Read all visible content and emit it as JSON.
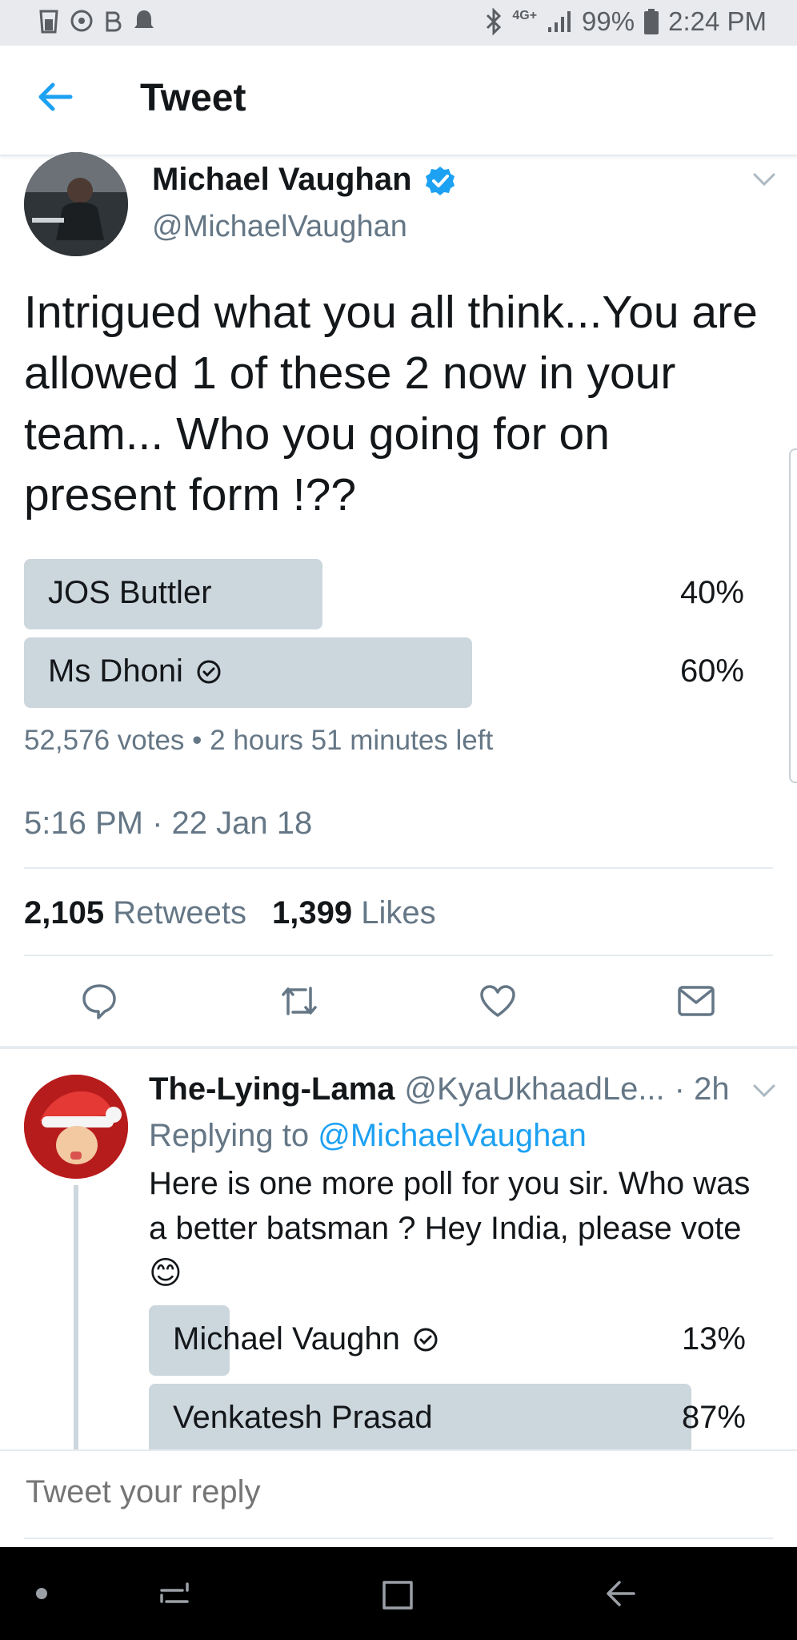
{
  "status_bar": {
    "battery": "99%",
    "network": "4G+",
    "time": "2:24 PM"
  },
  "header": {
    "title": "Tweet"
  },
  "tweet": {
    "author_name": "Michael Vaughan",
    "handle": "@MichaelVaughan",
    "verified": true,
    "text": "Intrigued what you all think...You are allowed 1 of these 2 now in your team... Who you going for on present form  !??",
    "poll": {
      "options": [
        {
          "label": "JOS Buttler",
          "percent": 40,
          "percent_text": "40%",
          "voted": false
        },
        {
          "label": "Ms Dhoni",
          "percent": 60,
          "percent_text": "60%",
          "voted": true
        }
      ],
      "summary": "52,576 votes • 2 hours 51 minutes left"
    },
    "timestamp": "5:16 PM · 22 Jan 18",
    "retweets_count": "2,105",
    "retweets_label": "Retweets",
    "likes_count": "1,399",
    "likes_label": "Likes"
  },
  "reply": {
    "author_name": "The-Lying-Lama",
    "handle": "@KyaUkhaadLe...",
    "time": "· 2h",
    "replying_prefix": "Replying to",
    "replying_to": "@MichaelVaughan",
    "text": "Here is one more poll for you sir. Who was a better batsman ? Hey India, please vote",
    "emoji": "😊",
    "poll": {
      "options": [
        {
          "label": "Michael Vaughn",
          "percent": 13,
          "percent_text": "13%",
          "voted": true
        },
        {
          "label": "Venkatesh Prasad",
          "percent": 87,
          "percent_text": "87%",
          "voted": false
        }
      ]
    }
  },
  "compose": {
    "placeholder": "Tweet your reply"
  },
  "colors": {
    "accent": "#1da1f2",
    "poll_bar": "#ccd6dd",
    "secondary_text": "#657786",
    "divider": "#e6ecf0"
  }
}
